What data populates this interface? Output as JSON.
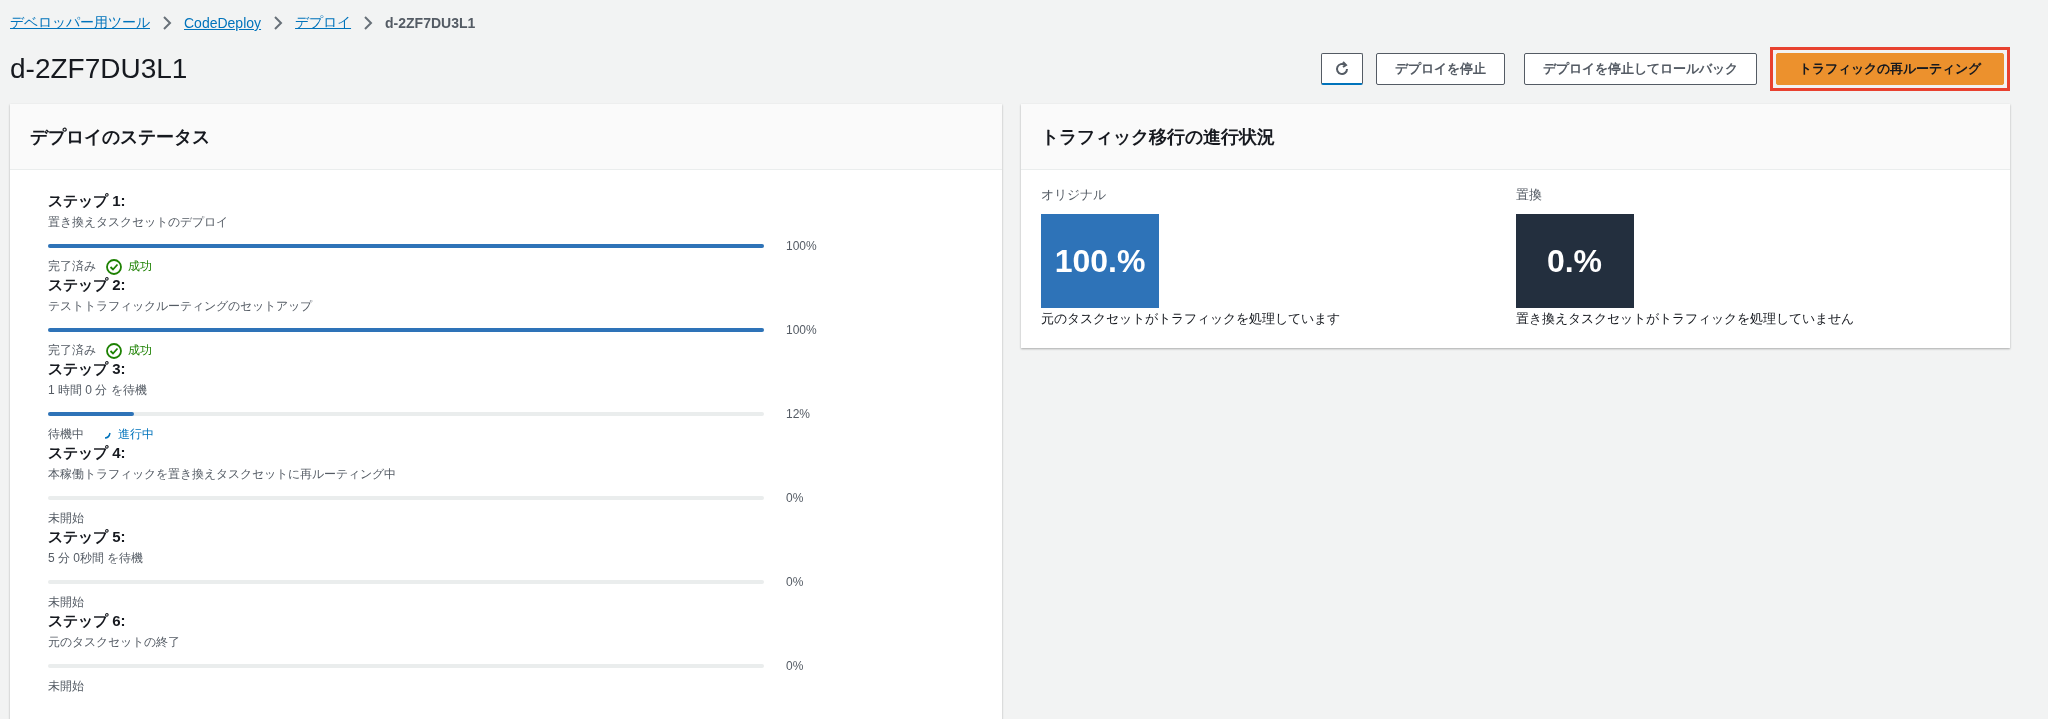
{
  "breadcrumbs": [
    {
      "label": "デベロッパー用ツール"
    },
    {
      "label": "CodeDeploy"
    },
    {
      "label": "デプロイ"
    },
    {
      "label": "d-2ZF7DU3L1"
    }
  ],
  "title": "d-2ZF7DU3L1",
  "actions": [
    {
      "kind": "refresh"
    },
    {
      "kind": "normal",
      "label": "デプロイを停止"
    },
    {
      "kind": "normal",
      "label": "デプロイを停止してロールバック"
    },
    {
      "kind": "primary",
      "label": "トラフィックの再ルーティング",
      "highlighted": true
    }
  ],
  "status_panel": {
    "title": "デプロイのステータス",
    "steps": [
      {
        "name": "ステップ 1:",
        "description": "置き換えタスクセットのデプロイ",
        "level": 1,
        "reading": "100%",
        "state": "完了済み",
        "kind": "success",
        "result": "成功"
      },
      {
        "name": "ステップ 2:",
        "description": "テストトラフィックルーティングのセットアップ",
        "level": 1,
        "reading": "100%",
        "state": "完了済み",
        "kind": "success",
        "result": "成功"
      },
      {
        "name": "ステップ 3:",
        "description": "1 時間 0 分 を待機",
        "level": 0.12,
        "reading": "12%",
        "state": "待機中",
        "kind": "progress",
        "result": "進行中"
      },
      {
        "name": "ステップ 4:",
        "description": "本稼働トラフィックを置き換えタスクセットに再ルーティング中",
        "level": 0,
        "reading": "0%",
        "state": "未開始",
        "kind": "none"
      },
      {
        "name": "ステップ 5:",
        "description": "5 分 0秒間 を待機",
        "level": 0,
        "reading": "0%",
        "state": "未開始",
        "kind": "none"
      },
      {
        "name": "ステップ 6:",
        "description": "元のタスクセットの終了",
        "level": 0,
        "reading": "0%",
        "state": "未開始",
        "kind": "none"
      }
    ]
  },
  "traffic_panel": {
    "title": "トラフィック移行の進行状況",
    "sets": [
      {
        "label": "オリジナル",
        "value": "100.%",
        "color": "#2e73b8",
        "caption": "元のタスクセットがトラフィックを処理しています"
      },
      {
        "label": "置換",
        "value": "0.%",
        "color": "#232f3e",
        "caption": "置き換えタスクセットがトラフィックを処理していません"
      }
    ]
  }
}
